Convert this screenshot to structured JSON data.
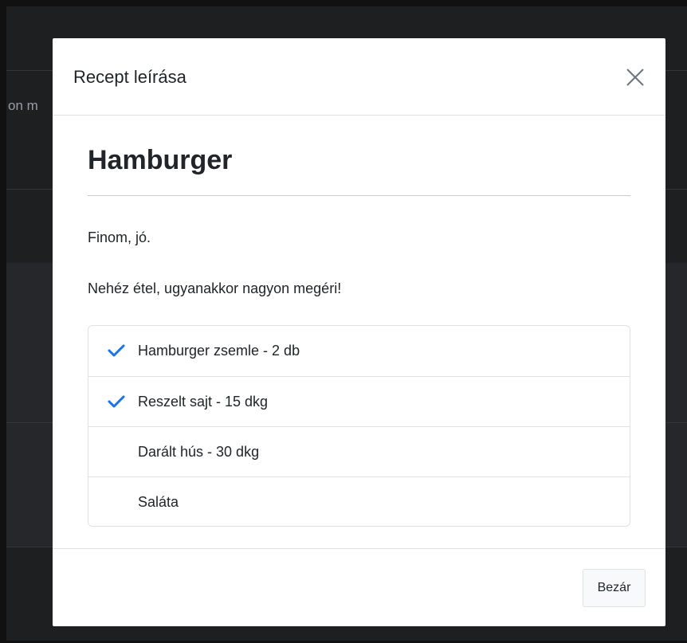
{
  "background": {
    "partial_text": "on m"
  },
  "modal": {
    "title": "Recept leírása",
    "close_icon": "close-icon",
    "recipe": {
      "name": "Hamburger",
      "short_description": "Finom, jó.",
      "description": "Nehéz étel, ugyanakkor nagyon megéri!",
      "ingredients": [
        {
          "label": "Hamburger zsemle - 2 db",
          "checked": true
        },
        {
          "label": "Reszelt sajt - 15 dkg",
          "checked": true
        },
        {
          "label": "Darált hús - 30 dkg",
          "checked": false
        },
        {
          "label": "Saláta",
          "checked": false
        }
      ]
    },
    "footer": {
      "close_label": "Bezár"
    }
  },
  "colors": {
    "check": "#1a73e8",
    "backdrop": "#1e1f21"
  }
}
